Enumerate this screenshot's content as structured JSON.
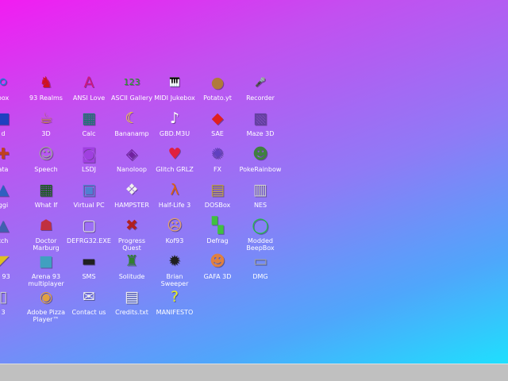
{
  "desktop": {
    "icons": [
      {
        "label": "box",
        "glyph": "⚪",
        "color": "#1b7be0"
      },
      {
        "label": "93 Realms",
        "glyph": "♞",
        "color": "#d01020"
      },
      {
        "label": "ANSI Love",
        "glyph": "A",
        "color": "#d01880"
      },
      {
        "label": "ASCII Gallery",
        "glyph": "123",
        "color": "#20a020"
      },
      {
        "label": "MIDI Jukebox",
        "glyph": "🎹",
        "color": "#202020"
      },
      {
        "label": "Potato.yt",
        "glyph": "●",
        "color": "#b07a3a"
      },
      {
        "label": "Recorder",
        "glyph": "🎤",
        "color": "#404040"
      },
      {
        "label": "d",
        "glyph": "■",
        "color": "#2040c0"
      },
      {
        "label": "3D",
        "glyph": "☕",
        "color": "#c08040"
      },
      {
        "label": "Calc",
        "glyph": "▦",
        "color": "#108070"
      },
      {
        "label": "Bananamp",
        "glyph": "☾",
        "color": "#f0e020"
      },
      {
        "label": "GBD.M3U",
        "glyph": "♪",
        "color": "#ffffff"
      },
      {
        "label": "SAE",
        "glyph": "◆",
        "color": "#e02020"
      },
      {
        "label": "Maze 3D",
        "glyph": "▩",
        "color": "#6040a0"
      },
      {
        "label": "ata",
        "glyph": "✚",
        "color": "#c04020"
      },
      {
        "label": "Speech",
        "glyph": "☺",
        "color": "#a0a0a0"
      },
      {
        "label": "LSDJ",
        "glyph": "◙",
        "color": "#a040e0"
      },
      {
        "label": "Nanoloop",
        "glyph": "◈",
        "color": "#7020a0"
      },
      {
        "label": "Glitch GRLZ",
        "glyph": "♥",
        "color": "#e02040"
      },
      {
        "label": "FX",
        "glyph": "✺",
        "color": "#6040c0"
      },
      {
        "label": "PokeRainbow",
        "glyph": "☻",
        "color": "#408040"
      },
      {
        "label": "ggi",
        "glyph": "▲",
        "color": "#3060c0"
      },
      {
        "label": "What If",
        "glyph": "▦",
        "color": "#106010"
      },
      {
        "label": "Virtual PC",
        "glyph": "▣",
        "color": "#5080d0"
      },
      {
        "label": "HAMPSTER",
        "glyph": "❖",
        "color": "#f0f0f0"
      },
      {
        "label": "Half-Life 3",
        "glyph": "λ",
        "color": "#e06010"
      },
      {
        "label": "DOSBox",
        "glyph": "▤",
        "color": "#c0a040"
      },
      {
        "label": "NES",
        "glyph": "▥",
        "color": "#d0d0d0"
      },
      {
        "label": "tch",
        "glyph": "▲",
        "color": "#4060b0"
      },
      {
        "label": "Doctor\nMarburg",
        "glyph": "☗",
        "color": "#c03040"
      },
      {
        "label": "DEFRG32.EXE",
        "glyph": "▢",
        "color": "#e0e0e0"
      },
      {
        "label": "Progress\nQuest",
        "glyph": "✖",
        "color": "#b02020"
      },
      {
        "label": "Kof93",
        "glyph": "☹",
        "color": "#e0a070"
      },
      {
        "label": "Defrag",
        "glyph": "▚",
        "color": "#40c040"
      },
      {
        "label": "Modded\nBeepBox",
        "glyph": "◯",
        "color": "#20c040"
      },
      {
        "label": "x 93",
        "glyph": "◤",
        "color": "#e0c020"
      },
      {
        "label": "Arena 93\nmultiplayer",
        "glyph": "■",
        "color": "#40a0c0"
      },
      {
        "label": "SMS",
        "glyph": "▬",
        "color": "#202020"
      },
      {
        "label": "Solitude",
        "glyph": "♜",
        "color": "#308030"
      },
      {
        "label": "Brian\nSweeper",
        "glyph": "✹",
        "color": "#202020"
      },
      {
        "label": "GAFA 3D",
        "glyph": "☻",
        "color": "#e08040"
      },
      {
        "label": "DMG",
        "glyph": "▭",
        "color": "#a0a0a0"
      },
      {
        "label": "3",
        "glyph": "▯",
        "color": "#d0d0d0"
      },
      {
        "label": "Adobe Pizza\nPlayer™",
        "glyph": "◉",
        "color": "#e0a040"
      },
      {
        "label": "Contact us",
        "glyph": "✉",
        "color": "#f0f0f0"
      },
      {
        "label": "Credits.txt",
        "glyph": "▤",
        "color": "#f0f0f0"
      },
      {
        "label": "MANIFESTO",
        "glyph": "?",
        "color": "#e8f020"
      }
    ]
  },
  "colors": {
    "taskbar": "#c0c0c0",
    "label_text": "#ffffff"
  }
}
